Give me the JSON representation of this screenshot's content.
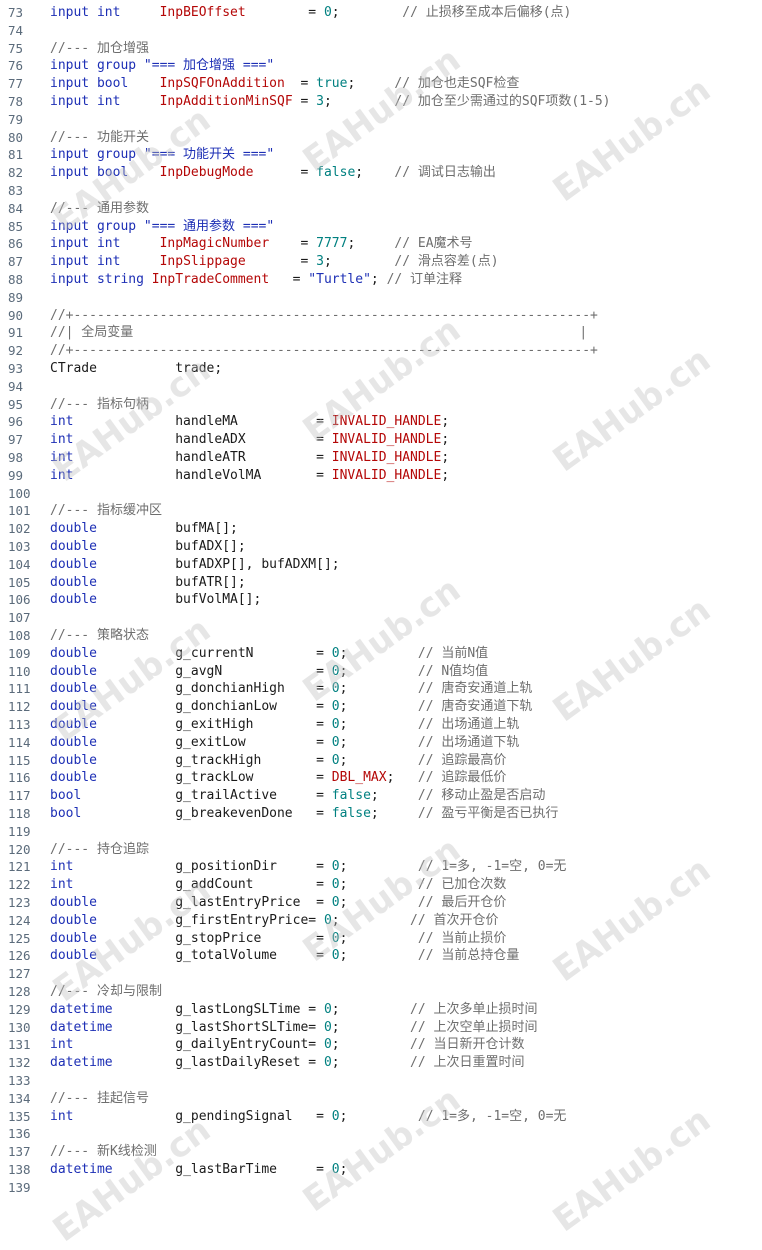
{
  "lines": [
    {
      "n": "73",
      "tokens": [
        {
          "t": "input int",
          "c": "kw"
        },
        {
          "t": "     "
        },
        {
          "t": "InpBEOffset",
          "c": "var"
        },
        {
          "t": "        = "
        },
        {
          "t": "0",
          "c": "num"
        },
        {
          "t": ";"
        },
        {
          "t": "        // 止损移至成本后偏移(点)",
          "c": "cm"
        }
      ]
    },
    {
      "n": "74",
      "tokens": []
    },
    {
      "n": "75",
      "tokens": [
        {
          "t": "//--- 加仓增强",
          "c": "cm"
        }
      ]
    },
    {
      "n": "76",
      "tokens": [
        {
          "t": "input group",
          "c": "kw"
        },
        {
          "t": " "
        },
        {
          "t": "\"=== 加仓增强 ===\"",
          "c": "str"
        }
      ]
    },
    {
      "n": "77",
      "tokens": [
        {
          "t": "input bool",
          "c": "kw"
        },
        {
          "t": "    "
        },
        {
          "t": "InpSQFOnAddition",
          "c": "var"
        },
        {
          "t": "  = "
        },
        {
          "t": "true",
          "c": "num"
        },
        {
          "t": ";"
        },
        {
          "t": "     // 加仓也走SQF检查",
          "c": "cm"
        }
      ]
    },
    {
      "n": "78",
      "tokens": [
        {
          "t": "input int",
          "c": "kw"
        },
        {
          "t": "     "
        },
        {
          "t": "InpAdditionMinSQF",
          "c": "var"
        },
        {
          "t": " = "
        },
        {
          "t": "3",
          "c": "num"
        },
        {
          "t": ";"
        },
        {
          "t": "        // 加仓至少需通过的SQF项数(1-5)",
          "c": "cm"
        }
      ]
    },
    {
      "n": "79",
      "tokens": []
    },
    {
      "n": "80",
      "tokens": [
        {
          "t": "//--- 功能开关",
          "c": "cm"
        }
      ]
    },
    {
      "n": "81",
      "tokens": [
        {
          "t": "input group",
          "c": "kw"
        },
        {
          "t": " "
        },
        {
          "t": "\"=== 功能开关 ===\"",
          "c": "str"
        }
      ]
    },
    {
      "n": "82",
      "tokens": [
        {
          "t": "input bool",
          "c": "kw"
        },
        {
          "t": "    "
        },
        {
          "t": "InpDebugMode",
          "c": "var"
        },
        {
          "t": "      = "
        },
        {
          "t": "false",
          "c": "num"
        },
        {
          "t": ";"
        },
        {
          "t": "    // 调试日志输出",
          "c": "cm"
        }
      ]
    },
    {
      "n": "83",
      "tokens": []
    },
    {
      "n": "84",
      "tokens": [
        {
          "t": "//--- 通用参数",
          "c": "cm"
        }
      ]
    },
    {
      "n": "85",
      "tokens": [
        {
          "t": "input group",
          "c": "kw"
        },
        {
          "t": " "
        },
        {
          "t": "\"=== 通用参数 ===\"",
          "c": "str"
        }
      ]
    },
    {
      "n": "86",
      "tokens": [
        {
          "t": "input int",
          "c": "kw"
        },
        {
          "t": "     "
        },
        {
          "t": "InpMagicNumber",
          "c": "var"
        },
        {
          "t": "    = "
        },
        {
          "t": "7777",
          "c": "num"
        },
        {
          "t": ";"
        },
        {
          "t": "     // EA魔术号",
          "c": "cm"
        }
      ]
    },
    {
      "n": "87",
      "tokens": [
        {
          "t": "input int",
          "c": "kw"
        },
        {
          "t": "     "
        },
        {
          "t": "InpSlippage",
          "c": "var"
        },
        {
          "t": "       = "
        },
        {
          "t": "3",
          "c": "num"
        },
        {
          "t": ";"
        },
        {
          "t": "        // 滑点容差(点)",
          "c": "cm"
        }
      ]
    },
    {
      "n": "88",
      "tokens": [
        {
          "t": "input string",
          "c": "kw"
        },
        {
          "t": " "
        },
        {
          "t": "InpTradeComment",
          "c": "var"
        },
        {
          "t": "   = "
        },
        {
          "t": "\"Turtle\"",
          "c": "str"
        },
        {
          "t": ";"
        },
        {
          "t": " // 订单注释",
          "c": "cm"
        }
      ]
    },
    {
      "n": "89",
      "tokens": []
    },
    {
      "n": "90",
      "tokens": [
        {
          "t": "//+------------------------------------------------------------------+",
          "c": "cm"
        }
      ]
    },
    {
      "n": "91",
      "tokens": [
        {
          "t": "//| 全局变量                                                         |",
          "c": "cm"
        }
      ]
    },
    {
      "n": "92",
      "tokens": [
        {
          "t": "//+------------------------------------------------------------------+",
          "c": "cm"
        }
      ]
    },
    {
      "n": "93",
      "tokens": [
        {
          "t": "CTrade",
          "c": "plain"
        },
        {
          "t": "          trade;"
        }
      ]
    },
    {
      "n": "94",
      "tokens": []
    },
    {
      "n": "95",
      "tokens": [
        {
          "t": "//--- 指标句柄",
          "c": "cm"
        }
      ]
    },
    {
      "n": "96",
      "tokens": [
        {
          "t": "int",
          "c": "ty"
        },
        {
          "t": "             handleMA          = "
        },
        {
          "t": "INVALID_HANDLE",
          "c": "var"
        },
        {
          "t": ";"
        }
      ]
    },
    {
      "n": "97",
      "tokens": [
        {
          "t": "int",
          "c": "ty"
        },
        {
          "t": "             handleADX         = "
        },
        {
          "t": "INVALID_HANDLE",
          "c": "var"
        },
        {
          "t": ";"
        }
      ]
    },
    {
      "n": "98",
      "tokens": [
        {
          "t": "int",
          "c": "ty"
        },
        {
          "t": "             handleATR         = "
        },
        {
          "t": "INVALID_HANDLE",
          "c": "var"
        },
        {
          "t": ";"
        }
      ]
    },
    {
      "n": "99",
      "tokens": [
        {
          "t": "int",
          "c": "ty"
        },
        {
          "t": "             handleVolMA       = "
        },
        {
          "t": "INVALID_HANDLE",
          "c": "var"
        },
        {
          "t": ";"
        }
      ]
    },
    {
      "n": "100",
      "tokens": []
    },
    {
      "n": "101",
      "tokens": [
        {
          "t": "//--- 指标缓冲区",
          "c": "cm"
        }
      ]
    },
    {
      "n": "102",
      "tokens": [
        {
          "t": "double",
          "c": "ty"
        },
        {
          "t": "          bufMA[];"
        }
      ]
    },
    {
      "n": "103",
      "tokens": [
        {
          "t": "double",
          "c": "ty"
        },
        {
          "t": "          bufADX[];"
        }
      ]
    },
    {
      "n": "104",
      "tokens": [
        {
          "t": "double",
          "c": "ty"
        },
        {
          "t": "          bufADXP[], bufADXM[];"
        }
      ]
    },
    {
      "n": "105",
      "tokens": [
        {
          "t": "double",
          "c": "ty"
        },
        {
          "t": "          bufATR[];"
        }
      ]
    },
    {
      "n": "106",
      "tokens": [
        {
          "t": "double",
          "c": "ty"
        },
        {
          "t": "          bufVolMA[];"
        }
      ]
    },
    {
      "n": "107",
      "tokens": []
    },
    {
      "n": "108",
      "tokens": [
        {
          "t": "//--- 策略状态",
          "c": "cm"
        }
      ]
    },
    {
      "n": "109",
      "tokens": [
        {
          "t": "double",
          "c": "ty"
        },
        {
          "t": "          g_currentN        = "
        },
        {
          "t": "0",
          "c": "num"
        },
        {
          "t": ";"
        },
        {
          "t": "         // 当前N值",
          "c": "cm"
        }
      ]
    },
    {
      "n": "110",
      "tokens": [
        {
          "t": "double",
          "c": "ty"
        },
        {
          "t": "          g_avgN            = "
        },
        {
          "t": "0",
          "c": "num"
        },
        {
          "t": ";"
        },
        {
          "t": "         // N值均值",
          "c": "cm"
        }
      ]
    },
    {
      "n": "111",
      "tokens": [
        {
          "t": "double",
          "c": "ty"
        },
        {
          "t": "          g_donchianHigh    = "
        },
        {
          "t": "0",
          "c": "num"
        },
        {
          "t": ";"
        },
        {
          "t": "         // 唐奇安通道上轨",
          "c": "cm"
        }
      ]
    },
    {
      "n": "112",
      "tokens": [
        {
          "t": "double",
          "c": "ty"
        },
        {
          "t": "          g_donchianLow     = "
        },
        {
          "t": "0",
          "c": "num"
        },
        {
          "t": ";"
        },
        {
          "t": "         // 唐奇安通道下轨",
          "c": "cm"
        }
      ]
    },
    {
      "n": "113",
      "tokens": [
        {
          "t": "double",
          "c": "ty"
        },
        {
          "t": "          g_exitHigh        = "
        },
        {
          "t": "0",
          "c": "num"
        },
        {
          "t": ";"
        },
        {
          "t": "         // 出场通道上轨",
          "c": "cm"
        }
      ]
    },
    {
      "n": "114",
      "tokens": [
        {
          "t": "double",
          "c": "ty"
        },
        {
          "t": "          g_exitLow         = "
        },
        {
          "t": "0",
          "c": "num"
        },
        {
          "t": ";"
        },
        {
          "t": "         // 出场通道下轨",
          "c": "cm"
        }
      ]
    },
    {
      "n": "115",
      "tokens": [
        {
          "t": "double",
          "c": "ty"
        },
        {
          "t": "          g_trackHigh       = "
        },
        {
          "t": "0",
          "c": "num"
        },
        {
          "t": ";"
        },
        {
          "t": "         // 追踪最高价",
          "c": "cm"
        }
      ]
    },
    {
      "n": "116",
      "tokens": [
        {
          "t": "double",
          "c": "ty"
        },
        {
          "t": "          g_trackLow        = "
        },
        {
          "t": "DBL_MAX",
          "c": "var"
        },
        {
          "t": ";"
        },
        {
          "t": "   // 追踪最低价",
          "c": "cm"
        }
      ]
    },
    {
      "n": "117",
      "tokens": [
        {
          "t": "bool",
          "c": "ty"
        },
        {
          "t": "            g_trailActive     = "
        },
        {
          "t": "false",
          "c": "num"
        },
        {
          "t": ";"
        },
        {
          "t": "     // 移动止盈是否启动",
          "c": "cm"
        }
      ]
    },
    {
      "n": "118",
      "tokens": [
        {
          "t": "bool",
          "c": "ty"
        },
        {
          "t": "            g_breakevenDone   = "
        },
        {
          "t": "false",
          "c": "num"
        },
        {
          "t": ";"
        },
        {
          "t": "     // 盈亏平衡是否已执行",
          "c": "cm"
        }
      ]
    },
    {
      "n": "119",
      "tokens": []
    },
    {
      "n": "120",
      "tokens": [
        {
          "t": "//--- 持仓追踪",
          "c": "cm"
        }
      ]
    },
    {
      "n": "121",
      "tokens": [
        {
          "t": "int",
          "c": "ty"
        },
        {
          "t": "             g_positionDir     = "
        },
        {
          "t": "0",
          "c": "num"
        },
        {
          "t": ";"
        },
        {
          "t": "         // 1=多, -1=空, 0=无",
          "c": "cm"
        }
      ]
    },
    {
      "n": "122",
      "tokens": [
        {
          "t": "int",
          "c": "ty"
        },
        {
          "t": "             g_addCount        = "
        },
        {
          "t": "0",
          "c": "num"
        },
        {
          "t": ";"
        },
        {
          "t": "         // 已加仓次数",
          "c": "cm"
        }
      ]
    },
    {
      "n": "123",
      "tokens": [
        {
          "t": "double",
          "c": "ty"
        },
        {
          "t": "          g_lastEntryPrice  = "
        },
        {
          "t": "0",
          "c": "num"
        },
        {
          "t": ";"
        },
        {
          "t": "         // 最后开仓价",
          "c": "cm"
        }
      ]
    },
    {
      "n": "124",
      "tokens": [
        {
          "t": "double",
          "c": "ty"
        },
        {
          "t": "          g_firstEntryPrice= "
        },
        {
          "t": "0",
          "c": "num"
        },
        {
          "t": ";"
        },
        {
          "t": "         // 首次开仓价",
          "c": "cm"
        }
      ]
    },
    {
      "n": "125",
      "tokens": [
        {
          "t": "double",
          "c": "ty"
        },
        {
          "t": "          g_stopPrice       = "
        },
        {
          "t": "0",
          "c": "num"
        },
        {
          "t": ";"
        },
        {
          "t": "         // 当前止损价",
          "c": "cm"
        }
      ]
    },
    {
      "n": "126",
      "tokens": [
        {
          "t": "double",
          "c": "ty"
        },
        {
          "t": "          g_totalVolume     = "
        },
        {
          "t": "0",
          "c": "num"
        },
        {
          "t": ";"
        },
        {
          "t": "         // 当前总持仓量",
          "c": "cm"
        }
      ]
    },
    {
      "n": "127",
      "tokens": []
    },
    {
      "n": "128",
      "tokens": [
        {
          "t": "//--- 冷却与限制",
          "c": "cm"
        }
      ]
    },
    {
      "n": "129",
      "tokens": [
        {
          "t": "datetime",
          "c": "ty"
        },
        {
          "t": "        g_lastLongSLTime = "
        },
        {
          "t": "0",
          "c": "num"
        },
        {
          "t": ";"
        },
        {
          "t": "         // 上次多单止损时间",
          "c": "cm"
        }
      ]
    },
    {
      "n": "130",
      "tokens": [
        {
          "t": "datetime",
          "c": "ty"
        },
        {
          "t": "        g_lastShortSLTime= "
        },
        {
          "t": "0",
          "c": "num"
        },
        {
          "t": ";"
        },
        {
          "t": "         // 上次空单止损时间",
          "c": "cm"
        }
      ]
    },
    {
      "n": "131",
      "tokens": [
        {
          "t": "int",
          "c": "ty"
        },
        {
          "t": "             g_dailyEntryCount= "
        },
        {
          "t": "0",
          "c": "num"
        },
        {
          "t": ";"
        },
        {
          "t": "         // 当日新开仓计数",
          "c": "cm"
        }
      ]
    },
    {
      "n": "132",
      "tokens": [
        {
          "t": "datetime",
          "c": "ty"
        },
        {
          "t": "        g_lastDailyReset = "
        },
        {
          "t": "0",
          "c": "num"
        },
        {
          "t": ";"
        },
        {
          "t": "         // 上次日重置时间",
          "c": "cm"
        }
      ]
    },
    {
      "n": "133",
      "tokens": []
    },
    {
      "n": "134",
      "tokens": [
        {
          "t": "//--- 挂起信号",
          "c": "cm"
        }
      ]
    },
    {
      "n": "135",
      "tokens": [
        {
          "t": "int",
          "c": "ty"
        },
        {
          "t": "             g_pendingSignal   = "
        },
        {
          "t": "0",
          "c": "num"
        },
        {
          "t": ";"
        },
        {
          "t": "         // 1=多, -1=空, 0=无",
          "c": "cm"
        }
      ]
    },
    {
      "n": "136",
      "tokens": []
    },
    {
      "n": "137",
      "tokens": [
        {
          "t": "//--- 新K线检测",
          "c": "cm"
        }
      ]
    },
    {
      "n": "138",
      "tokens": [
        {
          "t": "datetime",
          "c": "ty"
        },
        {
          "t": "        g_lastBarTime     = "
        },
        {
          "t": "0",
          "c": "num"
        },
        {
          "t": ";"
        }
      ]
    },
    {
      "n": "139",
      "tokens": []
    }
  ],
  "watermark": "EAHub.cn"
}
